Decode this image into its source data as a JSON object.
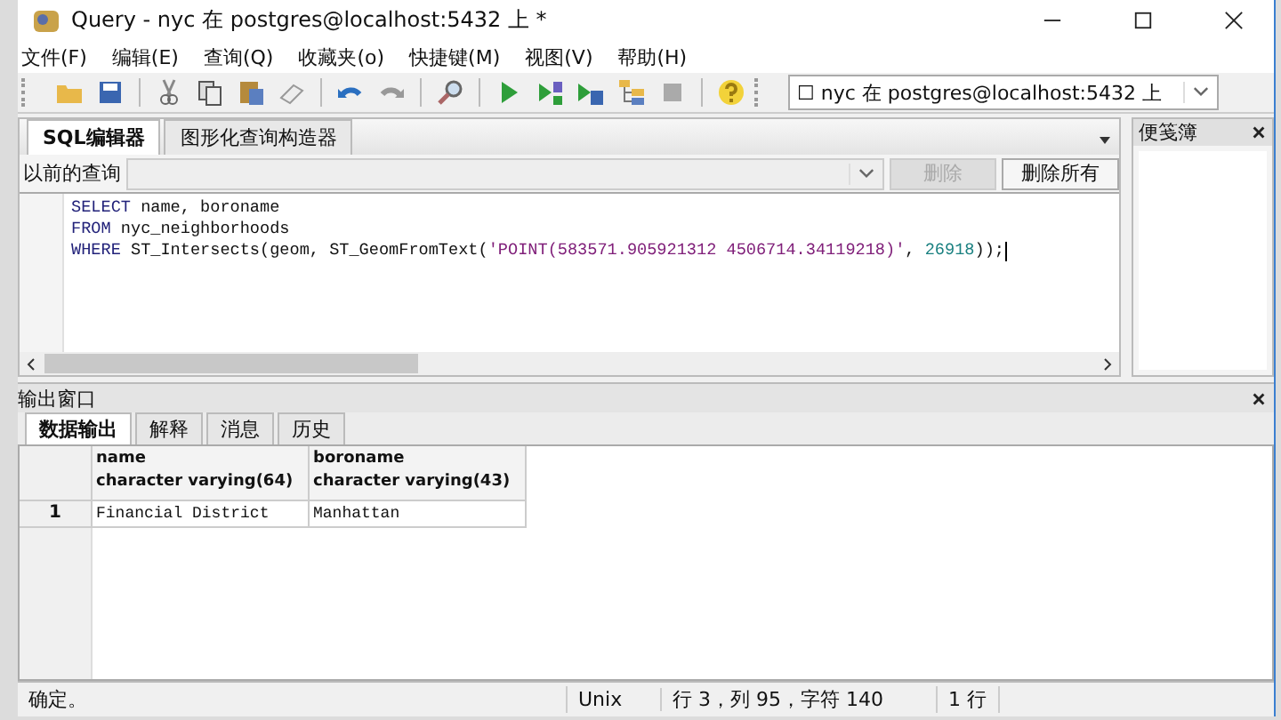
{
  "window": {
    "title": "Query - nyc 在  postgres@localhost:5432 上 *"
  },
  "menu": [
    "文件(F)",
    "编辑(E)",
    "查询(Q)",
    "收藏夹(o)",
    "快捷键(M)",
    "视图(V)",
    "帮助(H)"
  ],
  "connection": {
    "value": "☐ nyc 在  postgres@localhost:5432 上"
  },
  "editor_tabs": [
    {
      "label": "SQL编辑器",
      "selected": true
    },
    {
      "label": "图形化查询构造器",
      "selected": false
    }
  ],
  "previous_queries": {
    "label": "以前的查询",
    "buttons": [
      {
        "label": "删除",
        "disabled": true
      },
      {
        "label": "删除所有",
        "disabled": false
      }
    ]
  },
  "sql_lines": [
    [
      {
        "kind": "keyword",
        "text": "SELECT"
      },
      {
        "kind": "plain",
        "text": " name, boroname"
      }
    ],
    [
      {
        "kind": "keyword",
        "text": "FROM"
      },
      {
        "kind": "plain",
        "text": " nyc_neighborhoods"
      }
    ],
    [
      {
        "kind": "keyword",
        "text": "WHERE"
      },
      {
        "kind": "plain",
        "text": " ST_Intersects(geom, ST_GeomFromText("
      },
      {
        "kind": "string",
        "text": "'POINT(583571.905921312 4506714.34119218)'"
      },
      {
        "kind": "plain",
        "text": ", "
      },
      {
        "kind": "number",
        "text": "26918"
      },
      {
        "kind": "plain",
        "text": "));"
      }
    ]
  ],
  "scratch_pad": {
    "title": "便笺簿"
  },
  "output": {
    "title": "输出窗口",
    "tabs": [
      {
        "label": "数据输出",
        "selected": true
      },
      {
        "label": "解释",
        "selected": false
      },
      {
        "label": "消息",
        "selected": false
      },
      {
        "label": "历史",
        "selected": false
      }
    ],
    "columns": [
      {
        "name": "name",
        "type": "character varying(64)"
      },
      {
        "name": "boroname",
        "type": "character varying(43)"
      }
    ],
    "rows": [
      {
        "number": "1",
        "cells": [
          "Financial District",
          "Manhattan"
        ]
      }
    ]
  },
  "status_bar": [
    "确定。",
    "Unix",
    "行 3，列 95，字符 140",
    "1 行"
  ]
}
